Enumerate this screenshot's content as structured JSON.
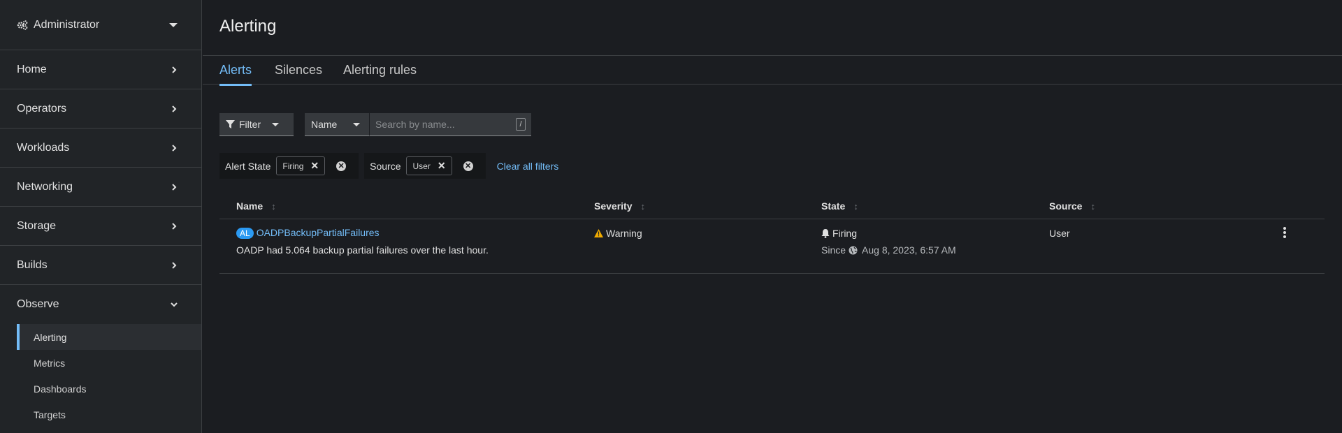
{
  "sidebar": {
    "perspective": "Administrator",
    "sections": [
      {
        "label": "Home"
      },
      {
        "label": "Operators"
      },
      {
        "label": "Workloads"
      },
      {
        "label": "Networking"
      },
      {
        "label": "Storage"
      },
      {
        "label": "Builds"
      }
    ],
    "expanded": {
      "label": "Observe",
      "items": [
        "Alerting",
        "Metrics",
        "Dashboards",
        "Targets"
      ]
    }
  },
  "page": {
    "title": "Alerting",
    "tabs": [
      "Alerts",
      "Silences",
      "Alerting rules"
    ]
  },
  "toolbar": {
    "filter_label": "Filter",
    "name_select": "Name",
    "search_placeholder": "Search by name...",
    "shortcut": "/"
  },
  "chips": [
    {
      "category": "Alert State",
      "value": "Firing"
    },
    {
      "category": "Source",
      "value": "User"
    }
  ],
  "clear_all": "Clear all filters",
  "table": {
    "headers": [
      "Name",
      "Severity",
      "State",
      "Source"
    ],
    "rows": [
      {
        "badge": "AL",
        "name": "OADPBackupPartialFailures",
        "description": "OADP had 5.064 backup partial failures over the last hour.",
        "severity": "Warning",
        "state": "Firing",
        "since_label": "Since",
        "since": "Aug 8, 2023, 6:57 AM",
        "source": "User"
      }
    ]
  },
  "colors": {
    "accent": "#73bcf7",
    "warning": "#f0ab00",
    "badge": "#2b9af3"
  }
}
